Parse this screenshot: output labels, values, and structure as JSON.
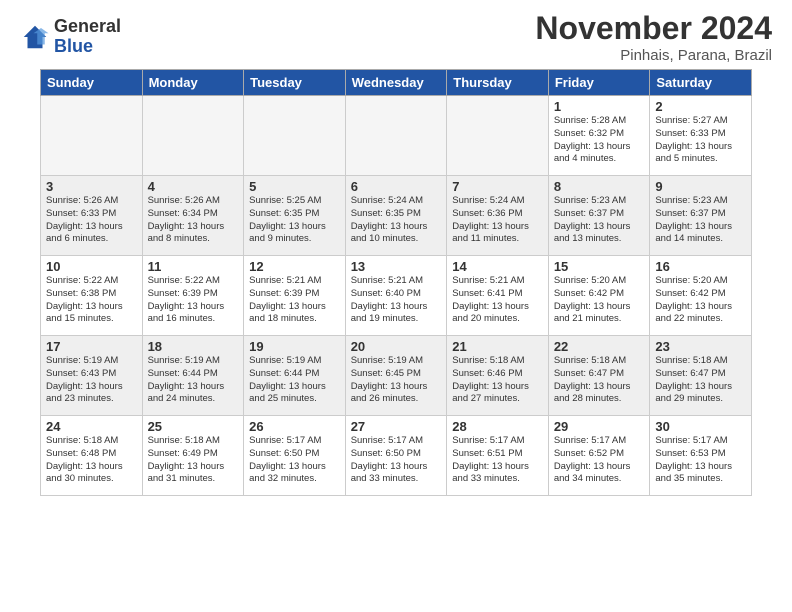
{
  "header": {
    "logo_general": "General",
    "logo_blue": "Blue",
    "month_title": "November 2024",
    "location": "Pinhais, Parana, Brazil"
  },
  "calendar": {
    "days_of_week": [
      "Sunday",
      "Monday",
      "Tuesday",
      "Wednesday",
      "Thursday",
      "Friday",
      "Saturday"
    ],
    "weeks": [
      [
        {
          "day": "",
          "info": "",
          "empty": true
        },
        {
          "day": "",
          "info": "",
          "empty": true
        },
        {
          "day": "",
          "info": "",
          "empty": true
        },
        {
          "day": "",
          "info": "",
          "empty": true
        },
        {
          "day": "",
          "info": "",
          "empty": true
        },
        {
          "day": "1",
          "info": "Sunrise: 5:28 AM\nSunset: 6:32 PM\nDaylight: 13 hours\nand 4 minutes."
        },
        {
          "day": "2",
          "info": "Sunrise: 5:27 AM\nSunset: 6:33 PM\nDaylight: 13 hours\nand 5 minutes."
        }
      ],
      [
        {
          "day": "3",
          "info": "Sunrise: 5:26 AM\nSunset: 6:33 PM\nDaylight: 13 hours\nand 6 minutes."
        },
        {
          "day": "4",
          "info": "Sunrise: 5:26 AM\nSunset: 6:34 PM\nDaylight: 13 hours\nand 8 minutes."
        },
        {
          "day": "5",
          "info": "Sunrise: 5:25 AM\nSunset: 6:35 PM\nDaylight: 13 hours\nand 9 minutes."
        },
        {
          "day": "6",
          "info": "Sunrise: 5:24 AM\nSunset: 6:35 PM\nDaylight: 13 hours\nand 10 minutes."
        },
        {
          "day": "7",
          "info": "Sunrise: 5:24 AM\nSunset: 6:36 PM\nDaylight: 13 hours\nand 11 minutes."
        },
        {
          "day": "8",
          "info": "Sunrise: 5:23 AM\nSunset: 6:37 PM\nDaylight: 13 hours\nand 13 minutes."
        },
        {
          "day": "9",
          "info": "Sunrise: 5:23 AM\nSunset: 6:37 PM\nDaylight: 13 hours\nand 14 minutes."
        }
      ],
      [
        {
          "day": "10",
          "info": "Sunrise: 5:22 AM\nSunset: 6:38 PM\nDaylight: 13 hours\nand 15 minutes."
        },
        {
          "day": "11",
          "info": "Sunrise: 5:22 AM\nSunset: 6:39 PM\nDaylight: 13 hours\nand 16 minutes."
        },
        {
          "day": "12",
          "info": "Sunrise: 5:21 AM\nSunset: 6:39 PM\nDaylight: 13 hours\nand 18 minutes."
        },
        {
          "day": "13",
          "info": "Sunrise: 5:21 AM\nSunset: 6:40 PM\nDaylight: 13 hours\nand 19 minutes."
        },
        {
          "day": "14",
          "info": "Sunrise: 5:21 AM\nSunset: 6:41 PM\nDaylight: 13 hours\nand 20 minutes."
        },
        {
          "day": "15",
          "info": "Sunrise: 5:20 AM\nSunset: 6:42 PM\nDaylight: 13 hours\nand 21 minutes."
        },
        {
          "day": "16",
          "info": "Sunrise: 5:20 AM\nSunset: 6:42 PM\nDaylight: 13 hours\nand 22 minutes."
        }
      ],
      [
        {
          "day": "17",
          "info": "Sunrise: 5:19 AM\nSunset: 6:43 PM\nDaylight: 13 hours\nand 23 minutes."
        },
        {
          "day": "18",
          "info": "Sunrise: 5:19 AM\nSunset: 6:44 PM\nDaylight: 13 hours\nand 24 minutes."
        },
        {
          "day": "19",
          "info": "Sunrise: 5:19 AM\nSunset: 6:44 PM\nDaylight: 13 hours\nand 25 minutes."
        },
        {
          "day": "20",
          "info": "Sunrise: 5:19 AM\nSunset: 6:45 PM\nDaylight: 13 hours\nand 26 minutes."
        },
        {
          "day": "21",
          "info": "Sunrise: 5:18 AM\nSunset: 6:46 PM\nDaylight: 13 hours\nand 27 minutes."
        },
        {
          "day": "22",
          "info": "Sunrise: 5:18 AM\nSunset: 6:47 PM\nDaylight: 13 hours\nand 28 minutes."
        },
        {
          "day": "23",
          "info": "Sunrise: 5:18 AM\nSunset: 6:47 PM\nDaylight: 13 hours\nand 29 minutes."
        }
      ],
      [
        {
          "day": "24",
          "info": "Sunrise: 5:18 AM\nSunset: 6:48 PM\nDaylight: 13 hours\nand 30 minutes."
        },
        {
          "day": "25",
          "info": "Sunrise: 5:18 AM\nSunset: 6:49 PM\nDaylight: 13 hours\nand 31 minutes."
        },
        {
          "day": "26",
          "info": "Sunrise: 5:17 AM\nSunset: 6:50 PM\nDaylight: 13 hours\nand 32 minutes."
        },
        {
          "day": "27",
          "info": "Sunrise: 5:17 AM\nSunset: 6:50 PM\nDaylight: 13 hours\nand 33 minutes."
        },
        {
          "day": "28",
          "info": "Sunrise: 5:17 AM\nSunset: 6:51 PM\nDaylight: 13 hours\nand 33 minutes."
        },
        {
          "day": "29",
          "info": "Sunrise: 5:17 AM\nSunset: 6:52 PM\nDaylight: 13 hours\nand 34 minutes."
        },
        {
          "day": "30",
          "info": "Sunrise: 5:17 AM\nSunset: 6:53 PM\nDaylight: 13 hours\nand 35 minutes."
        }
      ]
    ]
  }
}
